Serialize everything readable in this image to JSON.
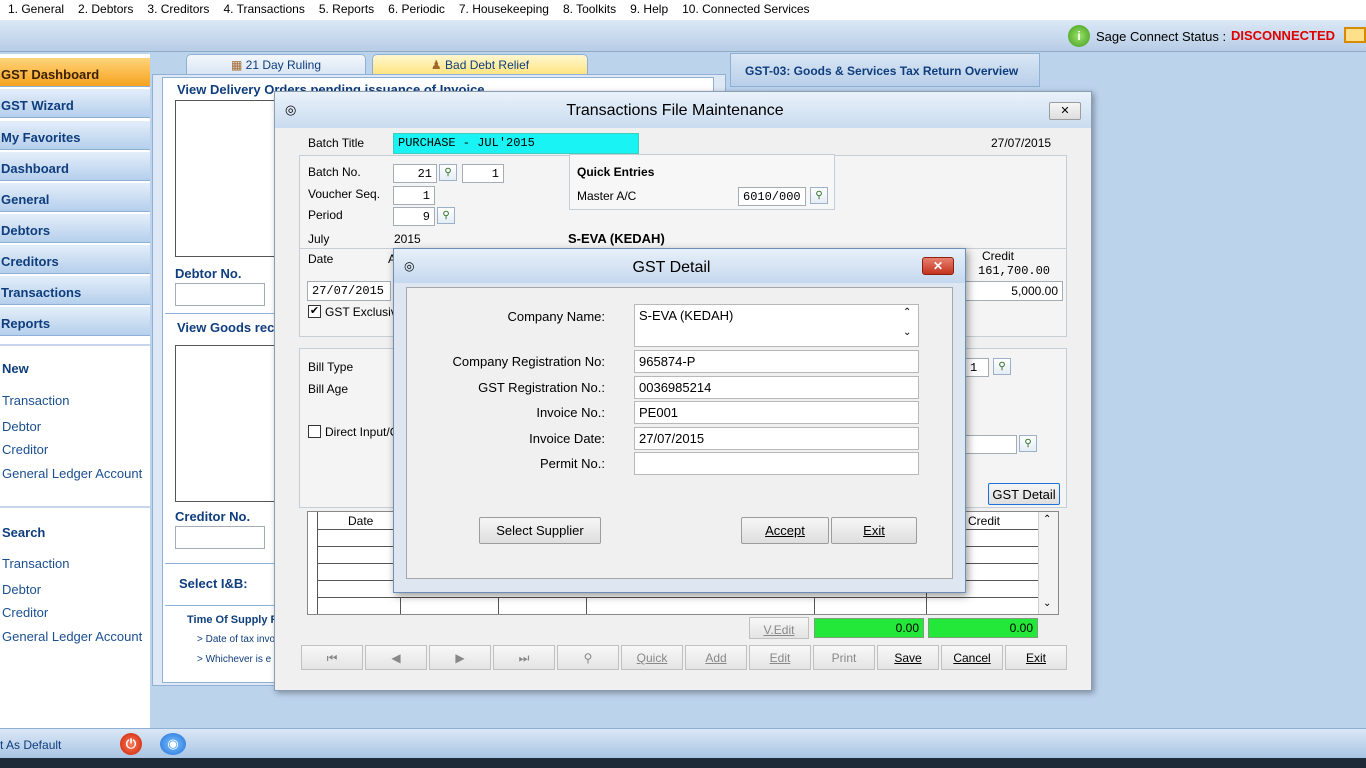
{
  "menu": [
    "1. General",
    "2. Debtors",
    "3. Creditors",
    "4. Transactions",
    "5. Reports",
    "6. Periodic",
    "7. Housekeeping",
    "8. Toolkits",
    "9. Help",
    "10. Connected Services"
  ],
  "status": {
    "label": "Sage Connect Status :",
    "value": "DISCONNECTED",
    "value_color": "#e00000"
  },
  "sidebar": {
    "items": [
      "GST Dashboard",
      "GST Wizard",
      "My Favorites",
      "Dashboard",
      "General",
      "Debtors",
      "Creditors",
      "Transactions",
      "Reports"
    ],
    "new_title": "New",
    "new_links": [
      "Transaction",
      "Debtor",
      "Creditor",
      "General Ledger Account"
    ],
    "search_title": "Search",
    "search_links": [
      "Transaction",
      "Debtor",
      "Creditor",
      "General Ledger Account"
    ],
    "set_default": "t As Default"
  },
  "tabs": {
    "ruling": "21 Day Ruling",
    "baddebt": "Bad Debt Relief",
    "gst03": "GST-03: Goods & Services Tax Return Overview"
  },
  "dashboard": {
    "delivery_orders": "View Delivery Orders pending issuance of Invoice",
    "debtor_no": "Debtor No.",
    "goods_rec": "View Goods rec",
    "creditor_no": "Creditor No.",
    "select_ib": "Select I&B:",
    "time_supply": "Time Of Supply R",
    "bullet1": "> Date of tax invo",
    "bullet2": "> Whichever is e"
  },
  "tfm": {
    "title": "Transactions File Maintenance",
    "batch_title_label": "Batch Title",
    "batch_title": "PURCHASE - JUL'2015",
    "date_top": "27/07/2015",
    "batch_no_label": "Batch No.",
    "batch_no": "21",
    "batch_seq": "1",
    "voucher_label": "Voucher Seq.",
    "voucher": "1",
    "period_label": "Period",
    "period": "9",
    "quick_title": "Quick Entries",
    "master_label": "Master A/C",
    "master": "6010/000",
    "month": "July",
    "year": "2015",
    "company": "S-EVA (KEDAH)",
    "date_label": "Date",
    "date_partial": "A",
    "date_value": "27/07/2015",
    "credit_label": "Credit",
    "credit_total": "161,700.00",
    "credit_value": "5,000.00",
    "gst_excl": "GST Exclusiv",
    "bill_type": "Bill Type",
    "bill_age": "Bill Age",
    "bill_val": "1",
    "direct_input": "Direct Input/O",
    "gst_detail_btn": "GST Detail",
    "grid_date": "Date",
    "grid_credit": "Credit",
    "vedit": "V.Edit",
    "total_debit": "0.00",
    "total_credit": "0.00",
    "toolbar": [
      "Quick",
      "Add",
      "Edit",
      "Print",
      "Save",
      "Cancel",
      "Exit"
    ]
  },
  "gst": {
    "title": "GST Detail",
    "company_name_label": "Company Name:",
    "company_name": "S-EVA (KEDAH)",
    "reg_no_label": "Company Registration No:",
    "reg_no": "965874-P",
    "gst_reg_label": "GST Registration No.:",
    "gst_reg": "0036985214",
    "invoice_no_label": "Invoice No.:",
    "invoice_no": "PE001",
    "invoice_date_label": "Invoice Date:",
    "invoice_date": "27/07/2015",
    "permit_label": "Permit No.:",
    "permit": "",
    "select_supplier": "Select Supplier",
    "accept": "Accept",
    "exit": "Exit"
  }
}
